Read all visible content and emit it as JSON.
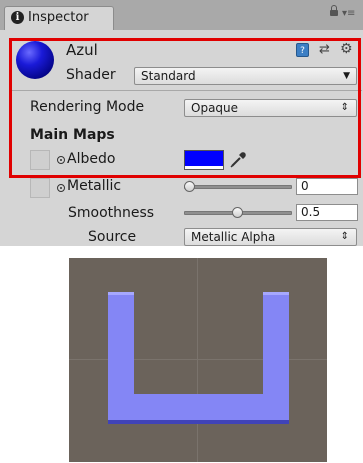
{
  "inspector": {
    "tab_label": "Inspector",
    "tab_icon_glyph": "i",
    "header": {
      "material_name": "Azul",
      "shader_label": "Shader",
      "shader_value": "Standard",
      "help_icon_glyph": "?",
      "preset_icon_glyph": "⇄",
      "gear_icon_glyph": "⚙",
      "menu_icon_glyph": "▾≡"
    },
    "rendering_mode": {
      "label": "Rendering Mode",
      "value": "Opaque"
    },
    "main_maps": {
      "section_label": "Main Maps",
      "albedo": {
        "label": "Albedo",
        "color": "#0000ff"
      },
      "metallic": {
        "label": "Metallic",
        "value": "0",
        "fraction": 0
      },
      "smoothness": {
        "label": "Smoothness",
        "value": "0.5",
        "fraction": 0.5
      },
      "source": {
        "label": "Source",
        "value": "Metallic Alpha"
      }
    },
    "highlight_color": "#e00000"
  },
  "scene": {
    "background_color": "#6b635b",
    "object_color": "#8486f5",
    "object_shape": "u-shape"
  }
}
